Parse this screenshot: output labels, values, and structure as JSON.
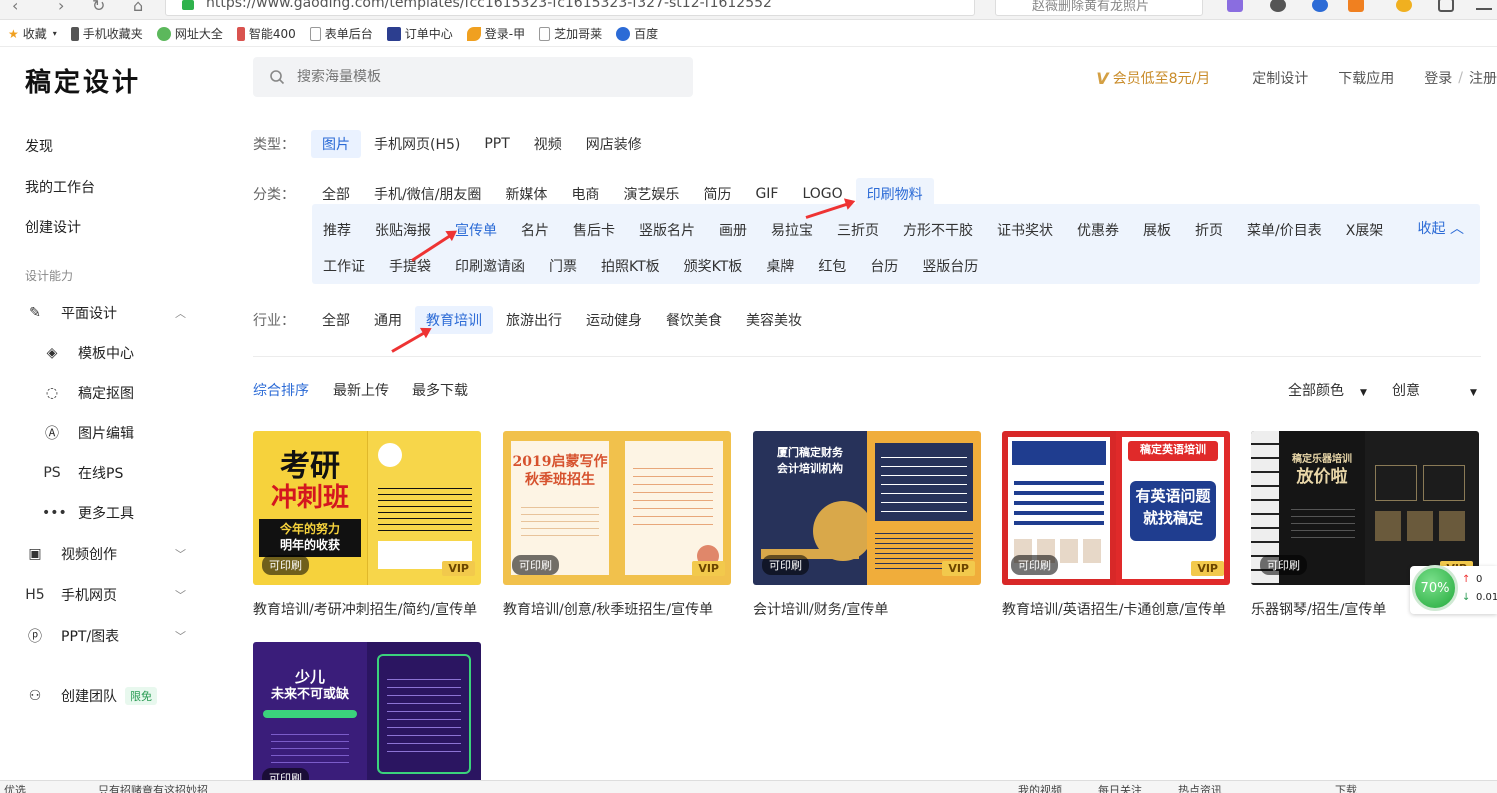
{
  "browser": {
    "url": "https://www.gaoding.com/templates/fcc1615323-fc1615323-f327-st12-f1612552",
    "search_placeholder": "赵薇删除黄有龙照片"
  },
  "bookmarks": [
    "收藏",
    "手机收藏夹",
    "网址大全",
    "智能400",
    "表单后台",
    "订单中心",
    "登录-甲",
    "芝加哥莱",
    "百度"
  ],
  "header": {
    "logo": "稿定设计",
    "search_placeholder": "搜索海量模板",
    "vip_text": "会员低至8元/月",
    "custom_design": "定制设计",
    "download_app": "下载应用",
    "login": "登录",
    "sep": "/",
    "register": "注册"
  },
  "sidebar": {
    "discover": "发现",
    "workspace": "我的工作台",
    "create": "创建设计",
    "group_title": "设计能力",
    "graphic": "平面设计",
    "template_center": "模板中心",
    "cutout": "稿定抠图",
    "image_edit": "图片编辑",
    "online_ps": "在线PS",
    "more_tools": "更多工具",
    "video": "视频创作",
    "h5": "手机网页",
    "ppt": "PPT/图表",
    "team": "创建团队",
    "team_badge": "限免",
    "icons": {
      "ps": "PS",
      "h5": "H5"
    }
  },
  "filters": {
    "type_label": "类型：",
    "types": [
      "图片",
      "手机网页(H5)",
      "PPT",
      "视频",
      "网店装修"
    ],
    "category_label": "分类：",
    "categories": [
      "全部",
      "手机/微信/朋友圈",
      "新媒体",
      "电商",
      "演艺娱乐",
      "简历",
      "GIF",
      "LOGO",
      "印刷物料"
    ],
    "sub_row1": [
      "推荐",
      "张贴海报",
      "宣传单",
      "名片",
      "售后卡",
      "竖版名片",
      "画册",
      "易拉宝",
      "三折页",
      "方形不干胶",
      "证书奖状",
      "优惠券",
      "展板",
      "折页",
      "菜单/价目表",
      "X展架"
    ],
    "sub_row2": [
      "工作证",
      "手提袋",
      "印刷邀请函",
      "门票",
      "拍照KT板",
      "颁奖KT板",
      "桌牌",
      "红包",
      "台历",
      "竖版台历"
    ],
    "collapse": "收起",
    "industry_label": "行业：",
    "industries": [
      "全部",
      "通用",
      "教育培训",
      "旅游出行",
      "运动健身",
      "餐饮美食",
      "美容美妆"
    ]
  },
  "sort": {
    "comprehensive": "综合排序",
    "latest": "最新上传",
    "most_downloaded": "最多下载",
    "color": "全部颜色",
    "creative": "创意"
  },
  "cards": [
    {
      "title": "教育培训/考研冲刺招生/简约/宣传单",
      "print": "可印刷",
      "vip": "VIP",
      "poster": [
        "考研",
        "冲刺班",
        "今年的努力",
        "明年的收获"
      ]
    },
    {
      "title": "教育培训/创意/秋季班招生/宣传单",
      "print": "可印刷",
      "vip": "VIP",
      "poster": [
        "2019启蒙写作",
        "秋季班招生"
      ]
    },
    {
      "title": "会计培训/财务/宣传单",
      "print": "可印刷",
      "vip": "VIP",
      "poster": [
        "厦门稿定财务",
        "会计培训机构"
      ]
    },
    {
      "title": "教育培训/英语招生/卡通创意/宣传单",
      "print": "可印刷",
      "vip": "VIP",
      "poster": [
        "稿定英语培训",
        "有英语问题",
        "就找稿定"
      ]
    },
    {
      "title": "乐器钢琴/招生/宣传单",
      "print": "可印刷",
      "vip": "VIP",
      "poster": [
        "稿定乐器培训",
        "放价啦"
      ]
    },
    {
      "title": "",
      "print": "可印刷",
      "vip": "",
      "poster": [
        "少儿",
        "未来不可或缺"
      ]
    }
  ],
  "widget": {
    "percent": "70%",
    "up": "0",
    "down": "0.01"
  },
  "statusbar": [
    "优选",
    "只有招赌竟有这招妙招",
    "我的视频",
    "每日关注",
    "热点资讯",
    "下载"
  ],
  "colors": {
    "accent": "#2c6bd6",
    "active_bg": "#eaf2ff",
    "subpanel_bg": "#eef4fd",
    "arrow": "#e33333",
    "vip_gold": "#c98c2a"
  }
}
